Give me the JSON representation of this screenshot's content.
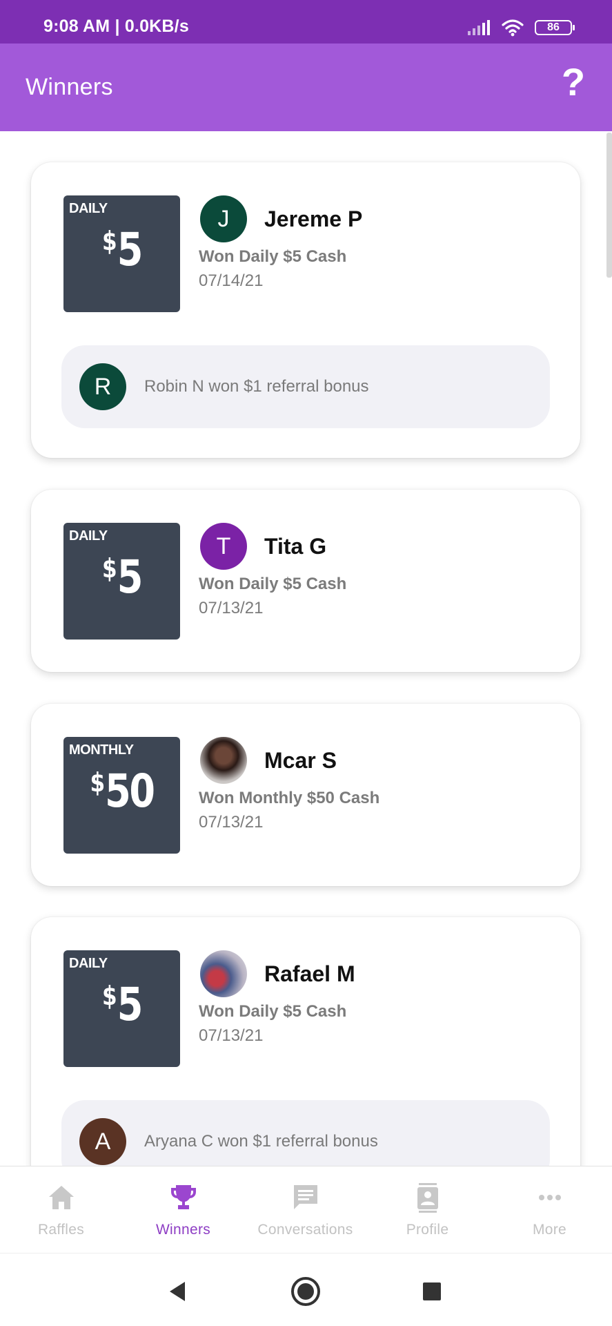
{
  "status_bar": {
    "time": "9:08 AM | 0.0KB/s",
    "battery": "86"
  },
  "app_bar": {
    "title": "Winners",
    "help_icon": "?"
  },
  "winners": [
    {
      "period": "DAILY",
      "amount": "5",
      "avatar_letter": "J",
      "avatar_color": "#0b4a3a",
      "name": "Jereme P",
      "won": "Won Daily $5 Cash",
      "date": "07/14/21",
      "referral": {
        "letter": "R",
        "color": "#0b4a3a",
        "text": "Robin N won $1 referral bonus"
      }
    },
    {
      "period": "DAILY",
      "amount": "5",
      "avatar_letter": "T",
      "avatar_color": "#7b22a6",
      "name": "Tita G",
      "won": "Won Daily $5 Cash",
      "date": "07/13/21"
    },
    {
      "period": "MONTHLY",
      "amount": "50",
      "avatar_letter": "",
      "avatar_color": "",
      "name": "Mcar S",
      "won": "Won Monthly $50 Cash",
      "date": "07/13/21"
    },
    {
      "period": "DAILY",
      "amount": "5",
      "avatar_letter": "",
      "avatar_color": "",
      "name": "Rafael M",
      "won": "Won Daily $5 Cash",
      "date": "07/13/21",
      "referral": {
        "letter": "A",
        "color": "#5a3324",
        "text": "Aryana C won $1 referral bonus"
      }
    }
  ],
  "bottom_nav": [
    {
      "label": "Raffles",
      "icon": "home-icon",
      "active": false
    },
    {
      "label": "Winners",
      "icon": "trophy-icon",
      "active": true
    },
    {
      "label": "Conversations",
      "icon": "chat-icon",
      "active": false
    },
    {
      "label": "Profile",
      "icon": "profile-icon",
      "active": false
    },
    {
      "label": "More",
      "icon": "more-dots-icon",
      "active": false
    }
  ],
  "colors": {
    "status_bar": "#7d2fb3",
    "app_bar": "#a259d9",
    "active_nav": "#8e3ec4",
    "prize_box": "#3d4654"
  }
}
